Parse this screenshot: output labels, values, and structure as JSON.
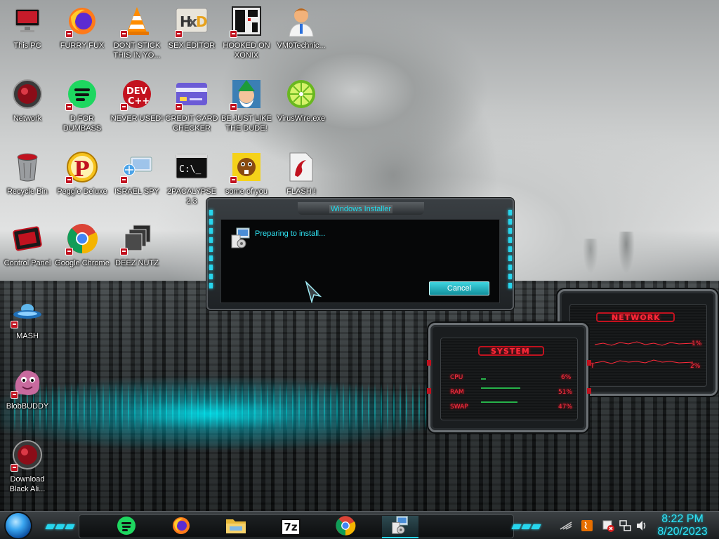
{
  "desktop": {
    "icons": [
      {
        "label": "This PC",
        "icon": "monitor-icon"
      },
      {
        "label": "FURRY FUX",
        "icon": "firefox-icon"
      },
      {
        "label": "DONT STICK THIS IN YO...",
        "icon": "vlc-cone-icon"
      },
      {
        "label": "SEX EDITOR",
        "icon": "hxd-editor-icon"
      },
      {
        "label": "HOOKED ON XONIX",
        "icon": "xonix-game-icon"
      },
      {
        "label": "VM0Technic...",
        "icon": "doctor-avatar-icon"
      },
      {
        "label": "Network",
        "icon": "red-orb-network-icon"
      },
      {
        "label": "D FOR DUMBASS",
        "icon": "spotify-style-icon"
      },
      {
        "label": "NEVER USED!",
        "icon": "devcpp-icon"
      },
      {
        "label": "CREDIT CARD CHECKER",
        "icon": "credit-card-icon"
      },
      {
        "label": "BE JUST LIKE THE DUDE!",
        "icon": "elf-portrait-icon"
      },
      {
        "label": "VirusWire.exe",
        "icon": "lime-icon"
      },
      {
        "label": "Recycle Bin",
        "icon": "recycle-bin-icon"
      },
      {
        "label": "Peggle Deluxe",
        "icon": "peggle-icon"
      },
      {
        "label": "ISRAEL SPY",
        "icon": "network-spy-icon"
      },
      {
        "label": "2PACALYPSE 2.3",
        "icon": "terminal-icon"
      },
      {
        "label": "some of you",
        "icon": "beaver-icon"
      },
      {
        "label": "FLASH !",
        "icon": "flash-document-icon"
      },
      {
        "label": "Control Panel",
        "icon": "control-panel-icon"
      },
      {
        "label": "Google Chrome",
        "icon": "chrome-icon"
      },
      {
        "label": "DEEZ NUTZ",
        "icon": "stacked-windows-icon"
      },
      {
        "label": "MASH",
        "icon": "ufo-icon"
      },
      {
        "label": "BlobBUDDY",
        "icon": "blob-buddy-icon"
      },
      {
        "label": "Download Black Ali...",
        "icon": "red-orb-download-icon"
      }
    ]
  },
  "installer": {
    "title": "Windows Installer",
    "message": "Preparing to install...",
    "cancel_label": "Cancel"
  },
  "gadgets": {
    "network": {
      "title": "NETWORK",
      "rows": [
        {
          "value": "1%"
        },
        {
          "label": "T",
          "value": "2%"
        }
      ]
    },
    "system": {
      "title": "SYSTEM",
      "rows": [
        {
          "label": "CPU",
          "value": "6%",
          "level": 0.06
        },
        {
          "label": "RAM",
          "value": "51%",
          "level": 0.51
        },
        {
          "label": "SWAP",
          "value": "47%",
          "level": 0.47
        }
      ]
    }
  },
  "taskbar": {
    "apps": [
      {
        "name": "spotify-style-app",
        "icon": "spotify-style-icon"
      },
      {
        "name": "firefox-app",
        "icon": "firefox-icon"
      },
      {
        "name": "file-explorer-app",
        "icon": "folder-icon"
      },
      {
        "name": "7zip-app",
        "icon": "7zip-icon",
        "label": "7z"
      },
      {
        "name": "chrome-app",
        "icon": "chrome-icon"
      },
      {
        "name": "windows-installer-app",
        "icon": "installer-icon",
        "active": true
      }
    ],
    "clock": {
      "time": "8:22 PM",
      "date": "8/20/2023"
    }
  },
  "colors": {
    "accent_cyan": "#27d6ee",
    "gadget_red": "#ff2a3a",
    "cancel_button": "#1ab3c2"
  }
}
